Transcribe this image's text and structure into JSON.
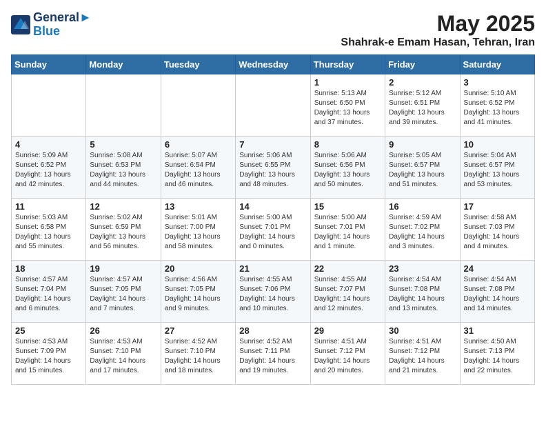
{
  "header": {
    "logo_line1": "General",
    "logo_line2": "Blue",
    "month": "May 2025",
    "location": "Shahrak-e Emam Hasan, Tehran, Iran"
  },
  "days_of_week": [
    "Sunday",
    "Monday",
    "Tuesday",
    "Wednesday",
    "Thursday",
    "Friday",
    "Saturday"
  ],
  "weeks": [
    [
      {
        "day": "",
        "text": ""
      },
      {
        "day": "",
        "text": ""
      },
      {
        "day": "",
        "text": ""
      },
      {
        "day": "",
        "text": ""
      },
      {
        "day": "1",
        "text": "Sunrise: 5:13 AM\nSunset: 6:50 PM\nDaylight: 13 hours and 37 minutes."
      },
      {
        "day": "2",
        "text": "Sunrise: 5:12 AM\nSunset: 6:51 PM\nDaylight: 13 hours and 39 minutes."
      },
      {
        "day": "3",
        "text": "Sunrise: 5:10 AM\nSunset: 6:52 PM\nDaylight: 13 hours and 41 minutes."
      }
    ],
    [
      {
        "day": "4",
        "text": "Sunrise: 5:09 AM\nSunset: 6:52 PM\nDaylight: 13 hours and 42 minutes."
      },
      {
        "day": "5",
        "text": "Sunrise: 5:08 AM\nSunset: 6:53 PM\nDaylight: 13 hours and 44 minutes."
      },
      {
        "day": "6",
        "text": "Sunrise: 5:07 AM\nSunset: 6:54 PM\nDaylight: 13 hours and 46 minutes."
      },
      {
        "day": "7",
        "text": "Sunrise: 5:06 AM\nSunset: 6:55 PM\nDaylight: 13 hours and 48 minutes."
      },
      {
        "day": "8",
        "text": "Sunrise: 5:06 AM\nSunset: 6:56 PM\nDaylight: 13 hours and 50 minutes."
      },
      {
        "day": "9",
        "text": "Sunrise: 5:05 AM\nSunset: 6:57 PM\nDaylight: 13 hours and 51 minutes."
      },
      {
        "day": "10",
        "text": "Sunrise: 5:04 AM\nSunset: 6:57 PM\nDaylight: 13 hours and 53 minutes."
      }
    ],
    [
      {
        "day": "11",
        "text": "Sunrise: 5:03 AM\nSunset: 6:58 PM\nDaylight: 13 hours and 55 minutes."
      },
      {
        "day": "12",
        "text": "Sunrise: 5:02 AM\nSunset: 6:59 PM\nDaylight: 13 hours and 56 minutes."
      },
      {
        "day": "13",
        "text": "Sunrise: 5:01 AM\nSunset: 7:00 PM\nDaylight: 13 hours and 58 minutes."
      },
      {
        "day": "14",
        "text": "Sunrise: 5:00 AM\nSunset: 7:01 PM\nDaylight: 14 hours and 0 minutes."
      },
      {
        "day": "15",
        "text": "Sunrise: 5:00 AM\nSunset: 7:01 PM\nDaylight: 14 hours and 1 minute."
      },
      {
        "day": "16",
        "text": "Sunrise: 4:59 AM\nSunset: 7:02 PM\nDaylight: 14 hours and 3 minutes."
      },
      {
        "day": "17",
        "text": "Sunrise: 4:58 AM\nSunset: 7:03 PM\nDaylight: 14 hours and 4 minutes."
      }
    ],
    [
      {
        "day": "18",
        "text": "Sunrise: 4:57 AM\nSunset: 7:04 PM\nDaylight: 14 hours and 6 minutes."
      },
      {
        "day": "19",
        "text": "Sunrise: 4:57 AM\nSunset: 7:05 PM\nDaylight: 14 hours and 7 minutes."
      },
      {
        "day": "20",
        "text": "Sunrise: 4:56 AM\nSunset: 7:05 PM\nDaylight: 14 hours and 9 minutes."
      },
      {
        "day": "21",
        "text": "Sunrise: 4:55 AM\nSunset: 7:06 PM\nDaylight: 14 hours and 10 minutes."
      },
      {
        "day": "22",
        "text": "Sunrise: 4:55 AM\nSunset: 7:07 PM\nDaylight: 14 hours and 12 minutes."
      },
      {
        "day": "23",
        "text": "Sunrise: 4:54 AM\nSunset: 7:08 PM\nDaylight: 14 hours and 13 minutes."
      },
      {
        "day": "24",
        "text": "Sunrise: 4:54 AM\nSunset: 7:08 PM\nDaylight: 14 hours and 14 minutes."
      }
    ],
    [
      {
        "day": "25",
        "text": "Sunrise: 4:53 AM\nSunset: 7:09 PM\nDaylight: 14 hours and 15 minutes."
      },
      {
        "day": "26",
        "text": "Sunrise: 4:53 AM\nSunset: 7:10 PM\nDaylight: 14 hours and 17 minutes."
      },
      {
        "day": "27",
        "text": "Sunrise: 4:52 AM\nSunset: 7:10 PM\nDaylight: 14 hours and 18 minutes."
      },
      {
        "day": "28",
        "text": "Sunrise: 4:52 AM\nSunset: 7:11 PM\nDaylight: 14 hours and 19 minutes."
      },
      {
        "day": "29",
        "text": "Sunrise: 4:51 AM\nSunset: 7:12 PM\nDaylight: 14 hours and 20 minutes."
      },
      {
        "day": "30",
        "text": "Sunrise: 4:51 AM\nSunset: 7:12 PM\nDaylight: 14 hours and 21 minutes."
      },
      {
        "day": "31",
        "text": "Sunrise: 4:50 AM\nSunset: 7:13 PM\nDaylight: 14 hours and 22 minutes."
      }
    ]
  ]
}
